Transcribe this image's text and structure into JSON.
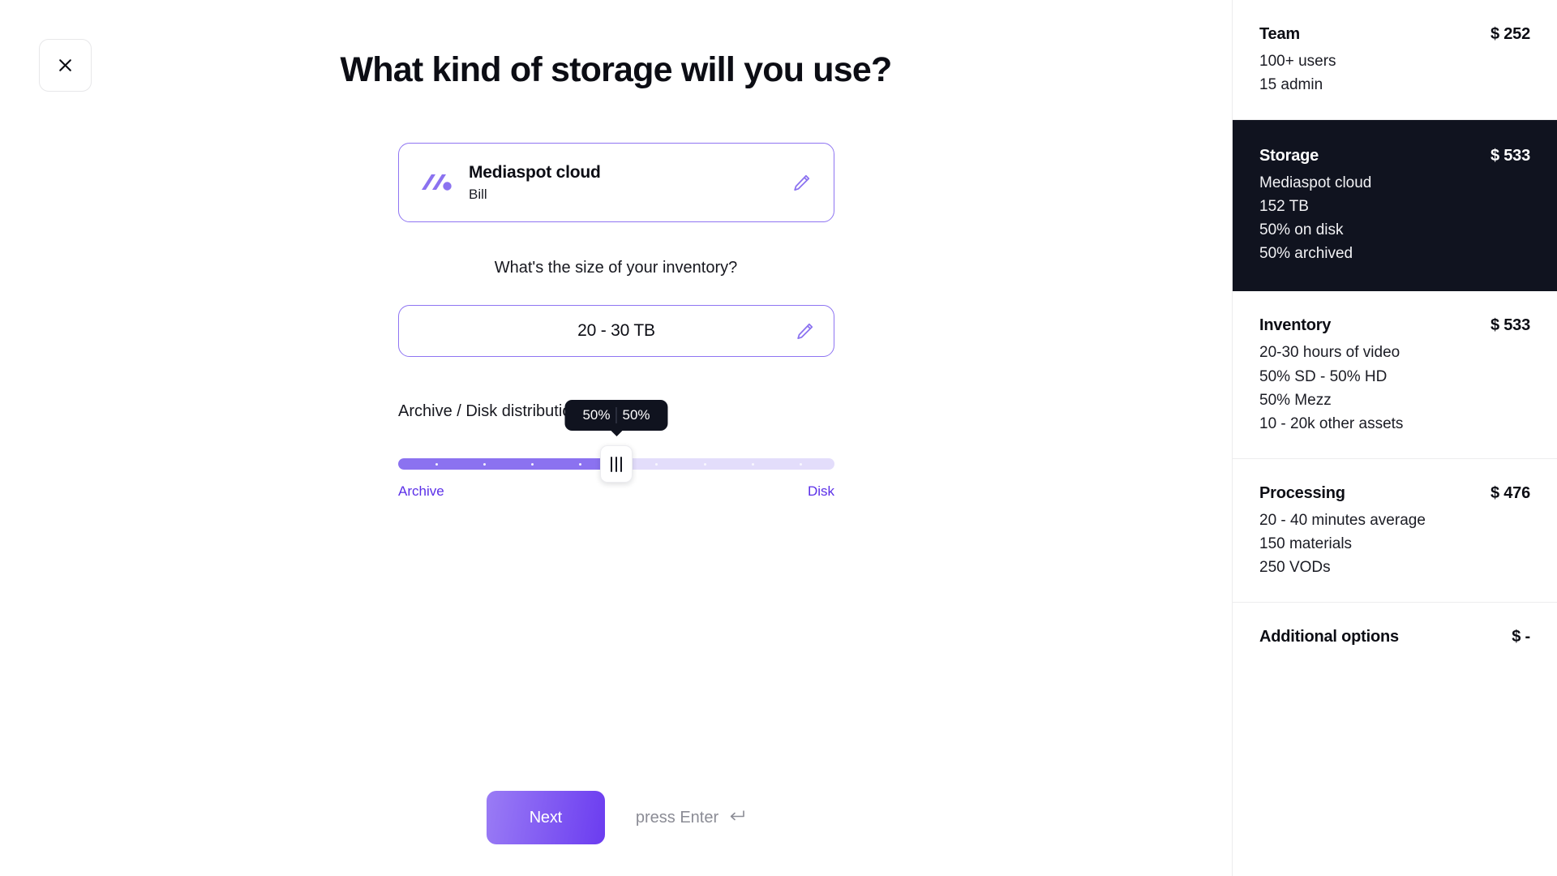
{
  "close_button": {
    "icon": "close-icon"
  },
  "main": {
    "title": "What kind of storage will you use?",
    "provider": {
      "logo": "mediaspot-logo-icon",
      "name": "Mediaspot cloud",
      "sub": "Bill",
      "edit_icon": "pencil-icon"
    },
    "inventory_question": "What's the size of your inventory?",
    "size_field": {
      "value": "20 - 30 TB",
      "edit_icon": "pencil-icon"
    },
    "slider": {
      "label": "Archive / Disk distribution",
      "left_label": "Archive",
      "right_label": "Disk",
      "left_value": "50%",
      "right_value": "50%",
      "position_percent": 50,
      "fill_color": "#8b72f0",
      "track_color": "#e3ddfb",
      "label_color": "#5b2fe8",
      "tick_count_left": 4,
      "tick_count_right": 4
    },
    "footer": {
      "next_label": "Next",
      "hint": "press Enter",
      "hint_icon": "enter-key-icon"
    }
  },
  "sidebar": {
    "sections": [
      {
        "title": "Team",
        "price": "$ 252",
        "lines": [
          "100+ users",
          "15 admin"
        ],
        "highlighted": false
      },
      {
        "title": "Storage",
        "price": "$ 533",
        "lines": [
          "Mediaspot cloud",
          "152 TB",
          "50% on disk",
          "50% archived"
        ],
        "highlighted": true
      },
      {
        "title": "Inventory",
        "price": "$ 533",
        "lines": [
          "20-30 hours of video",
          "50% SD - 50% HD",
          "50% Mezz",
          "10 - 20k other assets"
        ],
        "highlighted": false
      },
      {
        "title": "Processing",
        "price": "$ 476",
        "lines": [
          "20 - 40 minutes average",
          "150 materials",
          "250 VODs"
        ],
        "highlighted": false
      },
      {
        "title": "Additional options",
        "price": "$ -",
        "lines": [],
        "highlighted": false
      }
    ]
  },
  "colors": {
    "accent": "#6b3cf0",
    "accent_light": "#8f75f2",
    "dark_panel": "#10131f"
  }
}
